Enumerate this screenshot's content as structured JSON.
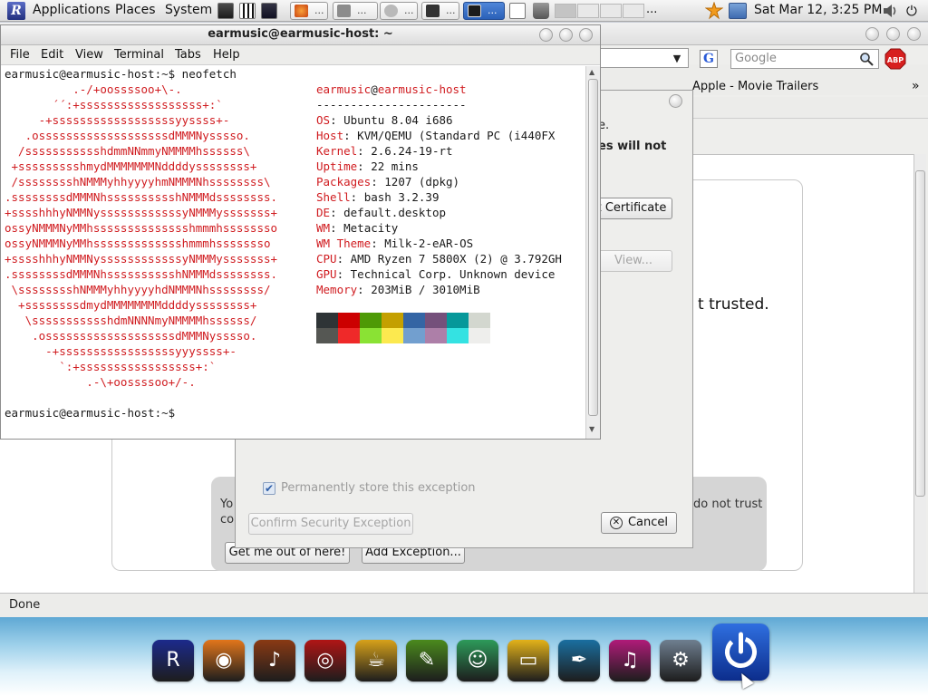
{
  "top_panel": {
    "menus": [
      "Applications",
      "Places",
      "System"
    ],
    "launchers": [
      "terminal-launcher",
      "piano-launcher",
      "music-launcher"
    ],
    "tasks": [
      {
        "label": "...",
        "icon": "firefox-icon"
      },
      {
        "label": "...",
        "icon": "settings-icon"
      },
      {
        "label": "...",
        "icon": "cloud-icon"
      },
      {
        "label": "...",
        "icon": "terminal-icon"
      },
      {
        "label": "...",
        "icon": "terminal-icon",
        "active": true
      }
    ],
    "workspace_label": "...",
    "datetime": "Sat Mar 12,  3:25 PM",
    "power_glyph": "⏻"
  },
  "firefox": {
    "search_placeholder": "Google",
    "bookmark": "Apple - Movie Trailers",
    "bookmarks_more": "»",
    "page_trusted_text": "t trusted.",
    "panel_text_left_1": "Yo",
    "panel_text_left_2": "co",
    "panel_text_right": "do not trust",
    "get_me_out_label": "Get me out of here!",
    "add_exception_label": "Add Exception...",
    "status": "Done"
  },
  "security_dialog": {
    "text_1": "e.",
    "text_2": "es will not",
    "get_certificate_label": "t Certificate",
    "view_label": "View...",
    "store_permanently_label": "Permanently store this exception",
    "store_permanently_checked": true,
    "confirm_label": "Confirm Security Exception",
    "cancel_label": "Cancel"
  },
  "terminal": {
    "title": "earmusic@earmusic-host: ~",
    "menu": [
      "File",
      "Edit",
      "View",
      "Terminal",
      "Tabs",
      "Help"
    ],
    "prompt_1": "earmusic@earmusic-host:~$ neofetch",
    "prompt_2": "earmusic@earmusic-host:~$",
    "logo_lines": [
      "          .-/+oossssoo+\\-.",
      "       ´´:+ssssssssssssssssss+:`",
      "     -+ssssssssssssssssssyyssss+-",
      "   .osssssssssssssssssssdMMMNysssso.",
      "  /ssssssssssshdmmNNmmyNMMMMhssssss\\",
      " +ssssssssshmydMMMMMMMNddddyssssssss+",
      " /sssssssshNMMMyhhyyyyhmNMMMNhssssssss\\",
      ".ssssssssdMMMNhsssssssssshNMMMdssssssss.",
      "+sssshhhyNMMNyssssssssssssyNMMMysssssss+",
      "ossyNMMMNyMMhsssssssssssssshmmmhssssssso",
      "ossyNMMMNyMMhssssssssssssshmmmhssssssso",
      "+sssshhhyNMMNyssssssssssssyNMMMysssssss+",
      ".ssssssssdMMMNhsssssssssshNMMMdssssssss.",
      " \\sssssssshNMMMyhhyyyyhdNMMMNhssssssss/",
      "  +ssssssssdmydMMMMMMMMddddyssssssss+",
      "   \\ssssssssssshdmNNNNmyNMMMMhssssss/",
      "    .osssssssssssssssssssdMMMNysssso.",
      "      -+sssssssssssssssssyyyssss+-",
      "        `:+sssssssssssssssss+:`",
      "            .-\\+oossssoo+/-."
    ],
    "user_host_user": "earmusic",
    "user_host_at": "@",
    "user_host_host": "earmusic-host",
    "separator": "----------------------",
    "info": [
      {
        "key": "OS",
        "value": "Ubuntu 8.04 i686"
      },
      {
        "key": "Host",
        "value": "KVM/QEMU (Standard PC (i440FX"
      },
      {
        "key": "Kernel",
        "value": "2.6.24-19-rt"
      },
      {
        "key": "Uptime",
        "value": "22 mins"
      },
      {
        "key": "Packages",
        "value": "1207 (dpkg)"
      },
      {
        "key": "Shell",
        "value": "bash 3.2.39"
      },
      {
        "key": "DE",
        "value": "default.desktop"
      },
      {
        "key": "WM",
        "value": "Metacity"
      },
      {
        "key": "WM Theme",
        "value": "Milk-2-eAR-OS"
      },
      {
        "key": "CPU",
        "value": "AMD Ryzen 7 5800X (2) @ 3.792GH"
      },
      {
        "key": "GPU",
        "value": "Technical Corp. Unknown device"
      },
      {
        "key": "Memory",
        "value": "203MiB / 3010MiB"
      }
    ],
    "palette_top": [
      "#2e3436",
      "#cc0000",
      "#4e9a06",
      "#c4a000",
      "#3465a4",
      "#75507b",
      "#06989a",
      "#d3d7cf"
    ],
    "palette_bottom": [
      "#555753",
      "#ef2929",
      "#8ae234",
      "#fce94f",
      "#729fcf",
      "#ad7fa8",
      "#34e2e2",
      "#eeeeec"
    ]
  },
  "dock": {
    "items": [
      {
        "name": "ear-os-logo-icon",
        "color": "#1c2a8c"
      },
      {
        "name": "firefox-icon",
        "color": "#e2761b"
      },
      {
        "name": "guitar-icon",
        "color": "#8a3a14"
      },
      {
        "name": "music-player-icon",
        "color": "#b01515"
      },
      {
        "name": "coffee-icon",
        "color": "#d7a11a"
      },
      {
        "name": "image-editor-icon",
        "color": "#4b8a1d"
      },
      {
        "name": "messenger-icon",
        "color": "#2d9a5a"
      },
      {
        "name": "office-icon",
        "color": "#e3b21a"
      },
      {
        "name": "drawing-icon",
        "color": "#1a6fa0"
      },
      {
        "name": "itunes-icon",
        "color": "#b01b79"
      },
      {
        "name": "system-settings-icon",
        "color": "#6f7f90"
      }
    ],
    "power": {
      "name": "power-icon",
      "color": "#1a4fc4"
    }
  }
}
